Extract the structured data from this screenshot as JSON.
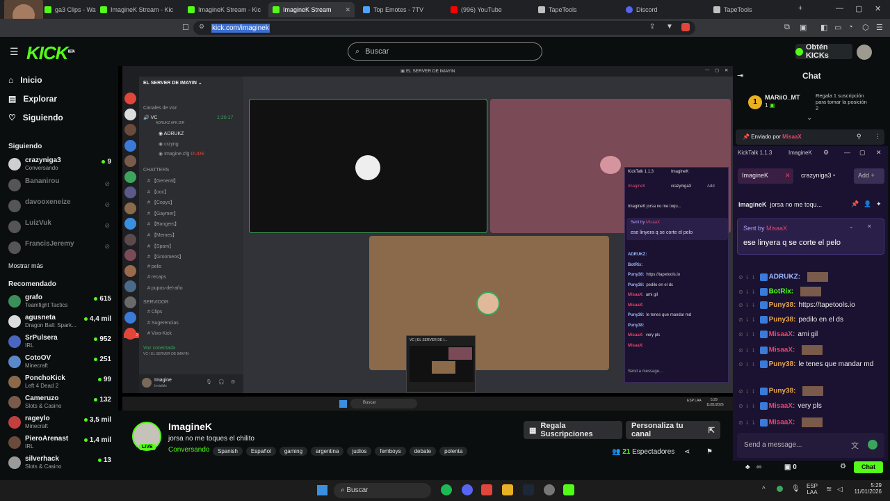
{
  "browser": {
    "tabs": [
      {
        "label": "ga3 Clips - Wat",
        "color": "#53fc18"
      },
      {
        "label": "ImagineK Stream - Kic",
        "color": "#53fc18"
      },
      {
        "label": "ImagineK Stream - Kic",
        "color": "#53fc18"
      },
      {
        "label": "ImagineK Stream",
        "color": "#53fc18"
      },
      {
        "label": "Top Emotes - 7TV",
        "color": "#4da3ff"
      },
      {
        "label": "(996) YouTube",
        "color": "#ff0000"
      },
      {
        "label": "TapeTools",
        "color": "#c0c0c0"
      },
      {
        "label": "Discord",
        "color": "#5865f2"
      },
      {
        "label": "TapeTools",
        "color": "#c0c0c0"
      }
    ],
    "url": "kick.com/imaginek",
    "win_controls": [
      "—",
      "□",
      "✕"
    ]
  },
  "kick": {
    "logo": "KICK",
    "logo_beta": "BETA",
    "search_placeholder": "Buscar",
    "get_kicks": "Obtén KICKs",
    "nav": [
      {
        "label": "Inicio",
        "icon": "home-icon"
      },
      {
        "label": "Explorar",
        "icon": "compass-icon"
      },
      {
        "label": "Siguiendo",
        "icon": "heart-icon"
      }
    ],
    "following_title": "Siguiendo",
    "following": [
      {
        "name": "crazyniga3",
        "sub": "Conversando",
        "viewers": "9",
        "live": true,
        "color": "#cfcfcf"
      },
      {
        "name": "Bananirou",
        "sub": "",
        "viewers": "",
        "live": false,
        "color": "#555"
      },
      {
        "name": "davooxeneize",
        "sub": "",
        "viewers": "",
        "live": false,
        "color": "#555"
      },
      {
        "name": "LuizVuk",
        "sub": "",
        "viewers": "",
        "live": false,
        "color": "#555"
      },
      {
        "name": "FrancisJeremy",
        "sub": "",
        "viewers": "",
        "live": false,
        "color": "#555"
      }
    ],
    "show_more": "Mostrar más",
    "recommended_title": "Recomendado",
    "recommended": [
      {
        "name": "grafo",
        "sub": "Teamfight Tactics",
        "viewers": "615",
        "color": "#3a8f5a"
      },
      {
        "name": "agusneta",
        "sub": "Dragon Ball: Spark...",
        "viewers": "4,4 mil",
        "color": "#dcdcdc"
      },
      {
        "name": "SrPulsera",
        "sub": "IRL",
        "viewers": "952",
        "color": "#4a66c0"
      },
      {
        "name": "CotoOV",
        "sub": "Minecraft",
        "viewers": "251",
        "color": "#5a88c8"
      },
      {
        "name": "PonchoKick",
        "sub": "Left 4 Dead 2",
        "viewers": "99",
        "color": "#8a6a4a"
      },
      {
        "name": "Cameruzo",
        "sub": "Slots & Casino",
        "viewers": "132",
        "color": "#7a5a4a"
      },
      {
        "name": "rageylo",
        "sub": "Minecraft",
        "viewers": "3,5 mil",
        "color": "#c04040"
      },
      {
        "name": "PieroArenast",
        "sub": "IRL",
        "viewers": "1,4 mil",
        "color": "#6a4a3a"
      },
      {
        "name": "silverhack",
        "sub": "Slots & Casino",
        "viewers": "13",
        "color": "#9a9a9a"
      }
    ],
    "streamer": {
      "name": "ImagineK",
      "title": "jorsa no me toques el chilito",
      "category": "Conversando",
      "live_badge": "LIVE",
      "tags": [
        "Spanish",
        "Español",
        "gaming",
        "argentina",
        "judios",
        "femboys",
        "debate",
        "polenta"
      ],
      "viewers": "21",
      "viewers_label": "Espectadores",
      "gift_button": "Regala Suscripciones",
      "customize_button": "Personaliza tu canal"
    },
    "chat": {
      "title": "Chat",
      "top_gifter": {
        "rank": "1",
        "name": "MARiiO_MT",
        "count": "1",
        "cta": "Regala 1 suscripción para tomar la posición 2"
      },
      "pinned_by_label": "Enviado por",
      "pinned_by": "MisaaX",
      "input_placeholder": "Enviar un mensaje...",
      "footer_count": "0",
      "chat_button": "Chat"
    }
  },
  "kicktalk": {
    "app_title": "KickTalk 1.1.3",
    "tab_active": "ImagineK",
    "chip_a": "ImagineK",
    "chip_b": "crazyniga3",
    "chip_b_suffix": "•",
    "add_label": "Add",
    "channel_header_name": "ImagineK",
    "channel_header_title": "jorsa no me toqu...",
    "sent_by_label": "Sent by",
    "sent_by_name": "MisaaX",
    "pinned_text": "ese linyera q se corte el pelo",
    "messages": [
      {
        "user": "ADRUKZ:",
        "text": "",
        "cls": "user-adrukz"
      },
      {
        "user": "BotRix:",
        "text": "",
        "cls": "user-botrix"
      },
      {
        "user": "Puny38:",
        "text": "https://tapetools.io",
        "cls": "user-puny"
      },
      {
        "user": "Puny38:",
        "text": "pedilo en el ds",
        "cls": "user-puny"
      },
      {
        "user": "MisaaX:",
        "text": "ami gil",
        "cls": "user-misa"
      },
      {
        "user": "MisaaX:",
        "text": "",
        "cls": "user-misa"
      },
      {
        "user": "Puny38:",
        "text": "le tenes que mandar md",
        "cls": "user-puny"
      },
      {
        "user": "Puny38:",
        "text": "",
        "cls": "user-puny"
      },
      {
        "user": "MisaaX:",
        "text": "very pls",
        "cls": "user-misa"
      },
      {
        "user": "MisaaX:",
        "text": "",
        "cls": "user-misa"
      }
    ],
    "input_placeholder": "Send a message...",
    "ttt_url_prefix": "ttps://tapetools.io"
  },
  "discord": {
    "server_name": "EL SERVER DE IMAYIN",
    "window_title": "EL SERVER DE IMAYIN",
    "voice_section": "Canales de voz",
    "voice_channel": "VC",
    "voice_sub": "ADRUKZ AFK.DIR",
    "voice_members": [
      "ADRUKZ",
      "crzyng",
      "Imagine.cfg"
    ],
    "voice_member_tag": "DUDE",
    "text_section": "CHATTERS",
    "text_channels": [
      "【General】",
      "【ooc】",
      "【Copys】",
      "【Gaymer】",
      "【Bangers】",
      "【Memes】",
      "【Spam】",
      "【Groomeos】",
      "pelis",
      "recaps",
      "pupos-del-año"
    ],
    "server_section": "SERVIDOR",
    "server_channels": [
      "Clips",
      "Sugerencias",
      "Vivo-Kick"
    ],
    "voice_connected": "Voz conectada",
    "voice_connected_sub": "VC / EL SERVER DE IMAYIN",
    "user": "Imagine",
    "user_status": "Invisible",
    "nuevo_badge": "NUEVO",
    "timer": "1:20:17",
    "preview_title": "VC | EL SERVER DE I..."
  },
  "inner_taskbar": {
    "search": "Buscar",
    "lang": "ESP LAA",
    "time": "5:29",
    "date": "11/01/2026"
  },
  "taskbar": {
    "search": "Buscar",
    "lang_a": "ESP",
    "lang_b": "LAA",
    "time": "5:29",
    "date": "11/01/2026"
  },
  "colors": {
    "kick_green": "#53fc18",
    "chat_purple": "#1a1230",
    "pink": "#e0466e"
  }
}
